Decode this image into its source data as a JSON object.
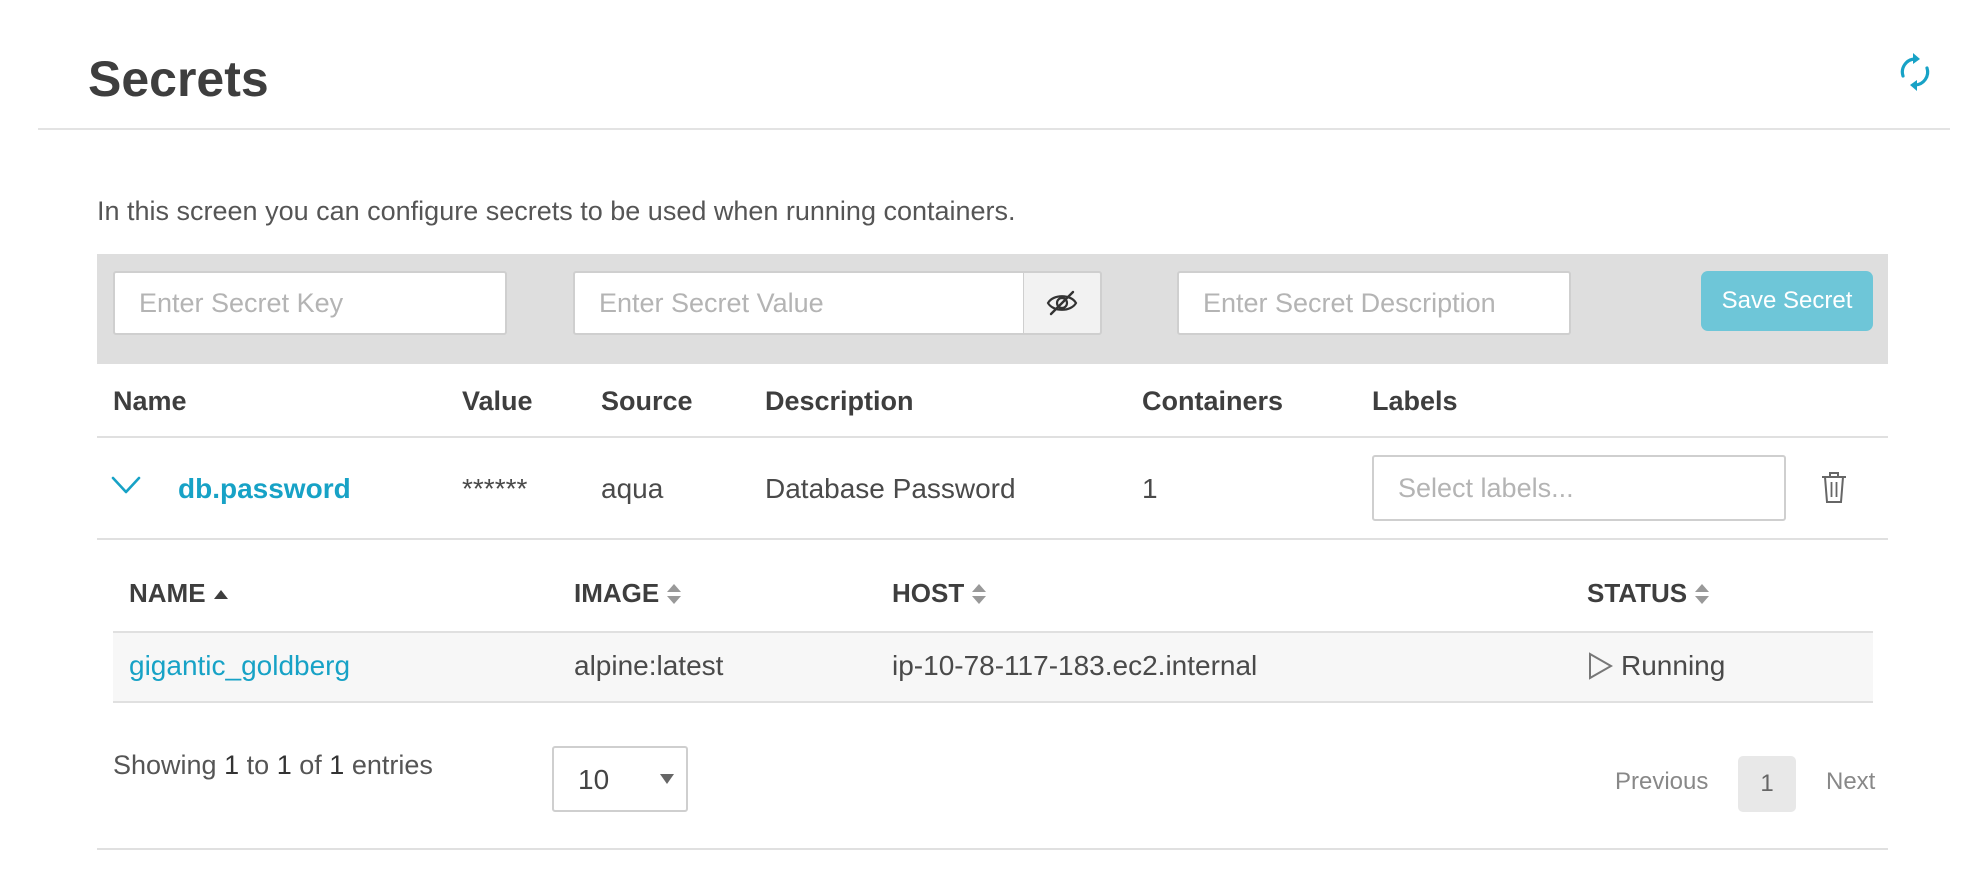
{
  "page": {
    "title": "Secrets",
    "intro": "In this screen you can configure secrets to be used when running containers."
  },
  "toolbar": {
    "key_placeholder": "Enter Secret Key",
    "value_placeholder": "Enter Secret Value",
    "description_placeholder": "Enter Secret Description",
    "save_label": "Save Secret"
  },
  "table": {
    "columns": [
      "Name",
      "Value",
      "Source",
      "Description",
      "Containers",
      "Labels"
    ],
    "rows": [
      {
        "name": "db.password",
        "value": "******",
        "source": "aqua",
        "description": "Database Password",
        "containers": "1",
        "labels_placeholder": "Select labels..."
      }
    ]
  },
  "containers": {
    "columns": [
      "NAME",
      "IMAGE",
      "HOST",
      "STATUS"
    ],
    "sort_column": "NAME",
    "sort_direction": "asc",
    "rows": [
      {
        "name": "gigantic_goldberg",
        "image": "alpine:latest",
        "host": "ip-10-78-117-183.ec2.internal",
        "status": "Running"
      }
    ]
  },
  "pagination": {
    "showing_prefix": "Showing",
    "from": "1",
    "to_word": "to",
    "to": "1",
    "of_word": "of",
    "total": "1",
    "entries_word": "entries",
    "page_size": "10",
    "previous_label": "Previous",
    "current_page": "1",
    "next_label": "Next"
  },
  "colors": {
    "accent": "#17a2c6",
    "save_button": "#6ec6d8",
    "toolbar_bg": "#dedede"
  },
  "icons": {
    "refresh": "refresh-icon",
    "eye_off": "eye-off-icon",
    "expand": "chevron-down-icon",
    "delete": "trash-icon",
    "status": "play-icon"
  }
}
